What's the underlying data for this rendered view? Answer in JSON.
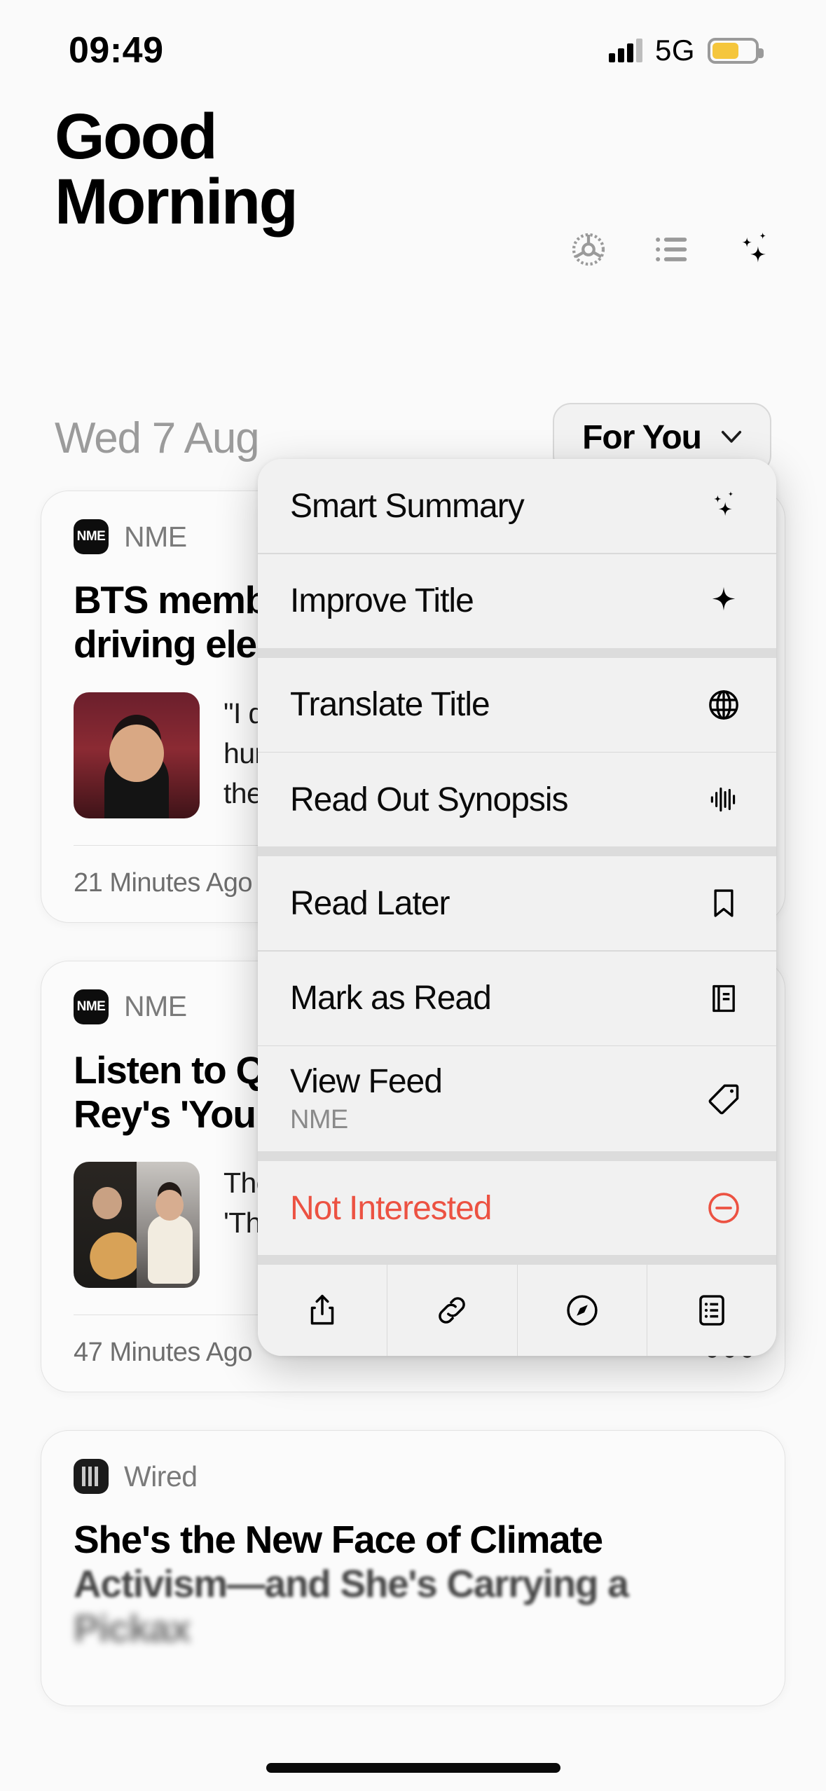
{
  "status_bar": {
    "time": "09:49",
    "network": "5G",
    "battery_color": "#f5c63c",
    "battery_level_pct": 62,
    "signal_icon": "cellular-bars-icon",
    "battery_icon": "battery-icon"
  },
  "header": {
    "greeting_line1": "Good",
    "greeting_line2": "Morning",
    "date": "Wed 7 Aug",
    "actions": [
      {
        "name": "settings-gear-icon",
        "label": "Settings"
      },
      {
        "name": "list-icon",
        "label": "List"
      },
      {
        "name": "sparkles-ai-icon",
        "label": "AI"
      }
    ],
    "feed_selector": {
      "label": "For You",
      "chevron_icon": "chevron-down-icon"
    }
  },
  "feed": {
    "articles": [
      {
        "source": "NME",
        "source_logo_text": "NME",
        "title": "BTS member Suga apologises for driving electric scooter intoxicated",
        "title_visible": "BTS memb… for driving… intoxicate…",
        "summary": "\"I deeply apologise to everyone who was hurt by my inappropriate behaviour,\" wrote the singer",
        "time": "21 Minutes Ago",
        "more_icon": "ellipsis-icon",
        "thumb": "bts-photo"
      },
      {
        "source": "NME",
        "source_logo_text": "NME",
        "title": "Listen to Quadeca cover Lana Del Rey's 'Young And Beautiful'",
        "title_visible": "Listen to Q… Del Rey's …",
        "summary": "The US rapper put his own spin on the 'The Great Gatsby' soundtrack cut",
        "time": "47 Minutes Ago",
        "more_icon": "ellipsis-icon",
        "thumb": "quadeca-lana-split-photo"
      },
      {
        "source": "Wired",
        "source_logo_text": "W",
        "title": "She's the New Face of Climate Activism—and She's Carrying a Pickax",
        "title_line1": "She's the New Face of Climate",
        "title_line2": "Activism—and She's Carrying a",
        "title_line3": "Pickax",
        "time": "",
        "more_icon": "ellipsis-icon",
        "thumb": "wired-photo"
      }
    ]
  },
  "context_menu": {
    "items": [
      {
        "label": "Smart Summary",
        "sub": "",
        "icon": "sparkles-icon",
        "style": "default",
        "group": 1
      },
      {
        "label": "Improve Title",
        "sub": "",
        "icon": "star-4point-icon",
        "style": "default",
        "group": 1
      },
      {
        "label": "Translate Title",
        "sub": "",
        "icon": "globe-icon",
        "style": "default",
        "group": 2
      },
      {
        "label": "Read Out Synopsis",
        "sub": "",
        "icon": "waveform-icon",
        "style": "default",
        "group": 2
      },
      {
        "label": "Read Later",
        "sub": "",
        "icon": "bookmark-icon",
        "style": "default",
        "group": 3
      },
      {
        "label": "Mark as Read",
        "sub": "",
        "icon": "book-icon",
        "style": "default",
        "group": 3
      },
      {
        "label": "View Feed",
        "sub": "NME",
        "icon": "tag-icon",
        "style": "default",
        "group": 3
      },
      {
        "label": "Not Interested",
        "sub": "",
        "icon": "minus-circle-icon",
        "style": "danger",
        "group": 4
      }
    ],
    "danger_color": "#ec5242",
    "toolbar": [
      {
        "name": "share-icon",
        "label": "Share"
      },
      {
        "name": "link-icon",
        "label": "Copy Link"
      },
      {
        "name": "safari-compass-icon",
        "label": "Open in Browser"
      },
      {
        "name": "reader-list-icon",
        "label": "Reader"
      }
    ]
  },
  "home_indicator": {
    "name": "home-indicator"
  }
}
